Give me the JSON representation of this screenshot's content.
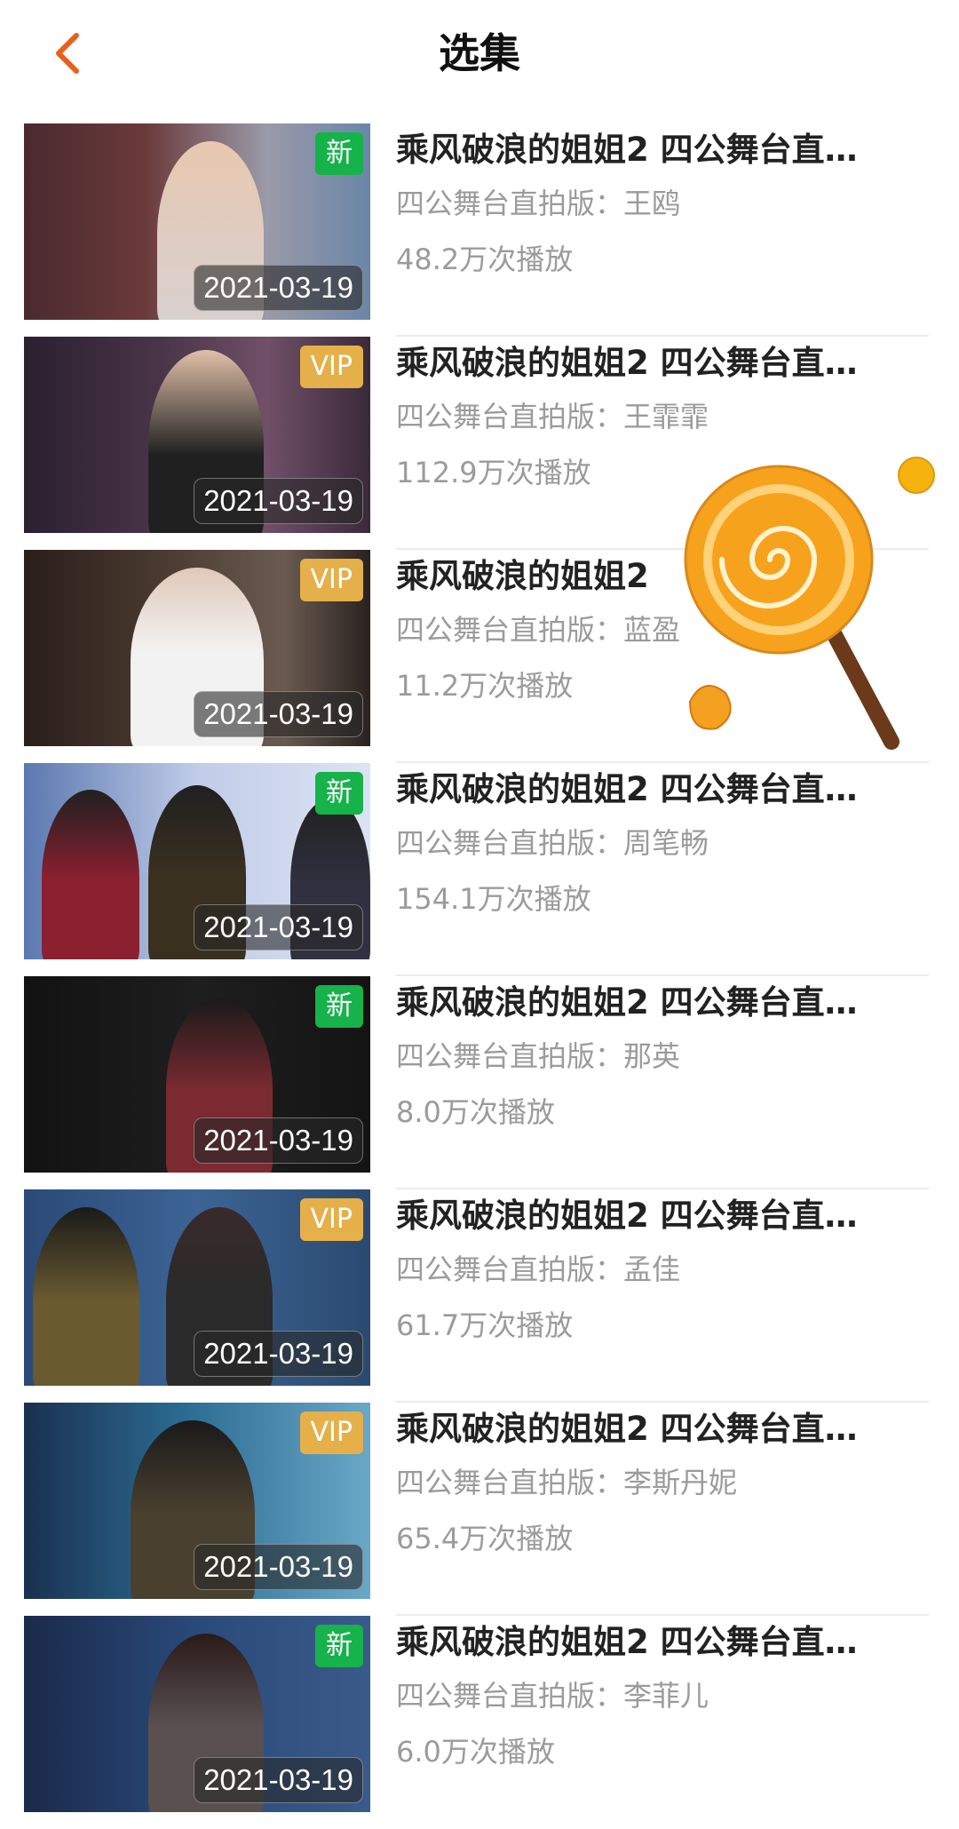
{
  "header": {
    "title": "选集",
    "back_icon": "chevron-left-icon",
    "accent_color": "#e8601c"
  },
  "episodes": [
    {
      "title": "乘风破浪的姐姐2 四公舞台直…",
      "subtitle": "四公舞台直拍版：王鸥",
      "plays": "48.2万次播放",
      "date": "2021-03-19",
      "badge": "新",
      "badge_type": "new"
    },
    {
      "title": "乘风破浪的姐姐2 四公舞台直…",
      "subtitle": "四公舞台直拍版：王霏霏",
      "plays": "112.9万次播放",
      "date": "2021-03-19",
      "badge": "VIP",
      "badge_type": "vip"
    },
    {
      "title": "乘风破浪的姐姐2",
      "subtitle": "四公舞台直拍版：蓝盈",
      "plays": "11.2万次播放",
      "date": "2021-03-19",
      "badge": "VIP",
      "badge_type": "vip"
    },
    {
      "title": "乘风破浪的姐姐2 四公舞台直…",
      "subtitle": "四公舞台直拍版：周笔畅",
      "plays": "154.1万次播放",
      "date": "2021-03-19",
      "badge": "新",
      "badge_type": "new"
    },
    {
      "title": "乘风破浪的姐姐2 四公舞台直…",
      "subtitle": "四公舞台直拍版：那英",
      "plays": "8.0万次播放",
      "date": "2021-03-19",
      "badge": "新",
      "badge_type": "new"
    },
    {
      "title": "乘风破浪的姐姐2 四公舞台直…",
      "subtitle": "四公舞台直拍版：孟佳",
      "plays": "61.7万次播放",
      "date": "2021-03-19",
      "badge": "VIP",
      "badge_type": "vip"
    },
    {
      "title": "乘风破浪的姐姐2 四公舞台直…",
      "subtitle": "四公舞台直拍版：李斯丹妮",
      "plays": "65.4万次播放",
      "date": "2021-03-19",
      "badge": "VIP",
      "badge_type": "vip"
    },
    {
      "title": "乘风破浪的姐姐2 四公舞台直…",
      "subtitle": "四公舞台直拍版：李菲儿",
      "plays": "6.0万次播放",
      "date": "2021-03-19",
      "badge": "新",
      "badge_type": "new"
    }
  ],
  "colors": {
    "badge_new": "#16b24a",
    "badge_vip": "#e5b04a",
    "secondary_text": "#9b9b9b"
  },
  "decoration": {
    "icon": "lollipop-sticker-icon"
  }
}
